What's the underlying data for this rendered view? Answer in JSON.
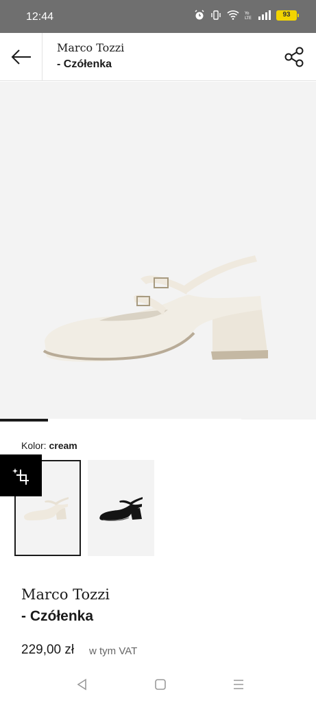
{
  "status_bar": {
    "time": "12:44",
    "battery": "93",
    "icons": [
      "alarm-icon",
      "vibrate-icon",
      "wifi-icon",
      "volte-icon",
      "signal-icon",
      "battery-icon"
    ]
  },
  "header": {
    "brand": "Marco Tozzi",
    "product": "- Czółenka",
    "back_icon": "arrow-left-icon",
    "share_icon": "share-icon"
  },
  "gallery": {
    "progress": 0.2,
    "wishlist_icon": "heart-icon",
    "bag_icon": "shopping-bag-icon"
  },
  "color": {
    "label": "Kolor:",
    "value": "cream"
  },
  "variants": [
    {
      "color": "cream",
      "selected": true
    },
    {
      "color": "black",
      "selected": false
    }
  ],
  "product": {
    "brand": "Marco Tozzi",
    "name": "- Czółenka",
    "price": "229,00 zł",
    "vat_note": "w tym VAT"
  },
  "nav_bar": {
    "icons": [
      "back-triangle-icon",
      "home-square-icon",
      "menu-lines-icon"
    ]
  },
  "colors": {
    "status_bar": "#6f6f6f",
    "image_bg": "#f3f3f3",
    "bag_button": "#3c3c3c",
    "shoe_cream": "#f1ede4",
    "shoe_black": "#141414"
  }
}
